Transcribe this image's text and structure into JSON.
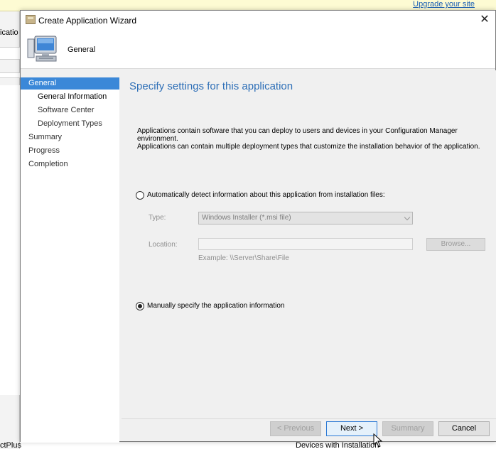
{
  "background": {
    "upgrade_link": "Upgrade your site",
    "left_partial_text": "icatio",
    "bottom_left_text": "ctPlus",
    "bottom_mid_text": "Devices with Installation"
  },
  "wizard": {
    "title": "Create Application Wizard",
    "header_title": "General",
    "close_glyph": "✕",
    "nav": [
      {
        "label": "General",
        "level": 0,
        "state": "selected"
      },
      {
        "label": "General Information",
        "level": 1,
        "state": "current"
      },
      {
        "label": "Software Center",
        "level": 1,
        "state": "normal"
      },
      {
        "label": "Deployment Types",
        "level": 1,
        "state": "normal"
      },
      {
        "label": "Summary",
        "level": 0,
        "state": "normal"
      },
      {
        "label": "Progress",
        "level": 0,
        "state": "normal"
      },
      {
        "label": "Completion",
        "level": 0,
        "state": "normal"
      }
    ],
    "content": {
      "title": "Specify settings for this application",
      "description_line1": "Applications contain software that you can deploy to users and devices in your Configuration Manager environment.",
      "description_line2": "Applications can contain multiple deployment types that customize the installation behavior of the application.",
      "auto_detect": {
        "label": "Automatically detect information about this application from installation files:",
        "checked": false
      },
      "type": {
        "label": "Type:",
        "value": "Windows Installer (*.msi file)"
      },
      "location": {
        "label": "Location:",
        "value": "",
        "browse_label": "Browse...",
        "example": "Example: \\\\Server\\Share\\File"
      },
      "manual": {
        "label": "Manually specify the application information",
        "checked": true
      }
    },
    "buttons": {
      "previous": "< Previous",
      "next": "Next >",
      "summary": "Summary",
      "cancel": "Cancel"
    }
  }
}
